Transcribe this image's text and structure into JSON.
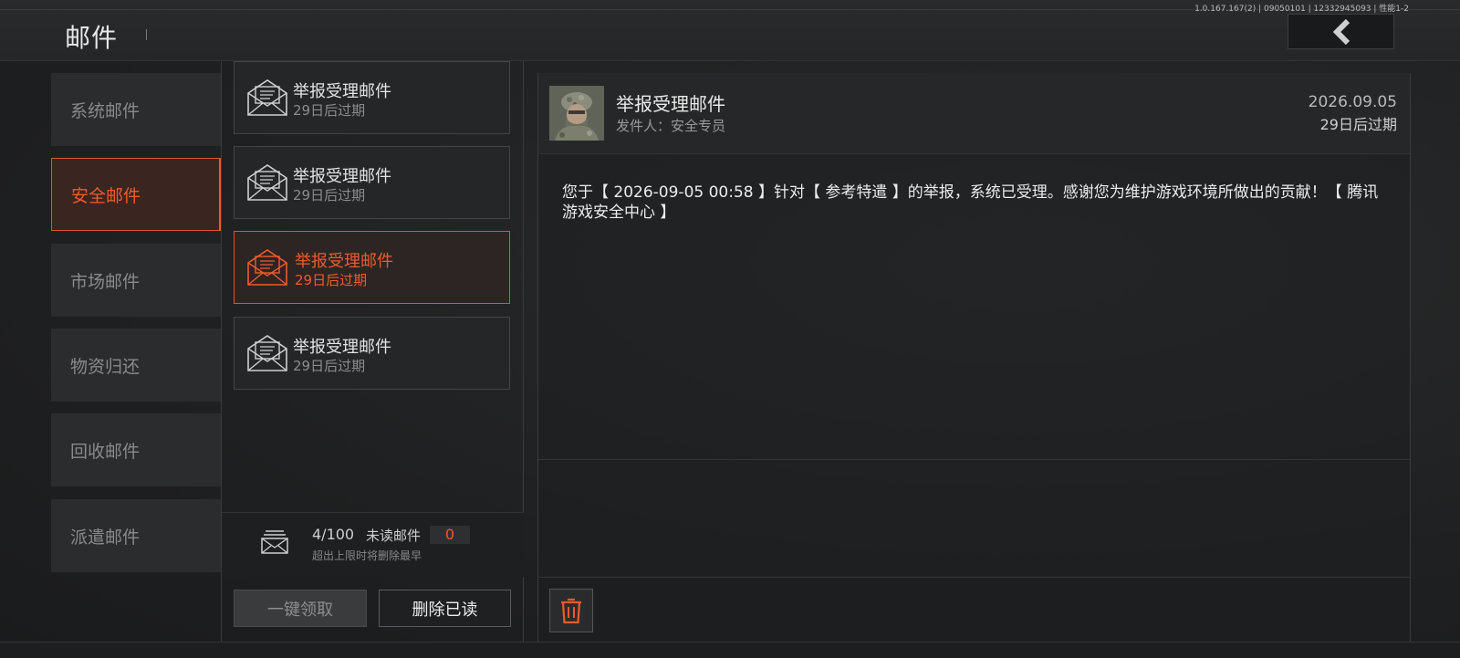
{
  "header": {
    "title": "邮件",
    "version": "1.0.167.167(2) | 09050101 | 12332945093 | 性能1-2",
    "back_icon": "chevron-left-icon"
  },
  "sidebar": {
    "items": [
      {
        "label": "系统邮件",
        "active": false
      },
      {
        "label": "安全邮件",
        "active": true
      },
      {
        "label": "市场邮件",
        "active": false
      },
      {
        "label": "物资归还",
        "active": false
      },
      {
        "label": "回收邮件",
        "active": false
      },
      {
        "label": "派遣邮件",
        "active": false
      }
    ]
  },
  "mail_list": {
    "items": [
      {
        "title": "举报受理邮件",
        "expiry": "29日后过期",
        "selected": false
      },
      {
        "title": "举报受理邮件",
        "expiry": "29日后过期",
        "selected": false
      },
      {
        "title": "举报受理邮件",
        "expiry": "29日后过期",
        "selected": true
      },
      {
        "title": "举报受理邮件",
        "expiry": "29日后过期",
        "selected": false
      }
    ],
    "count": "4/100",
    "unread_label": "未读邮件",
    "unread_count": "0",
    "limit_note": "超出上限时将删除最早",
    "claim_all_label": "一键领取",
    "delete_read_label": "删除已读"
  },
  "detail": {
    "title": "举报受理邮件",
    "sender": "发件人：安全专员",
    "date": "2026.09.05",
    "expiry": "29日后过期",
    "body": "您于【 2026-09-05 00:58 】针对【 参考特遣 】的举报，系统已受理。感谢您为维护游戏环境所做出的贡献！【 腾讯游戏安全中心 】",
    "delete_icon": "trash-icon"
  },
  "colors": {
    "accent": "#f05a2c",
    "background": "#1f2021"
  }
}
